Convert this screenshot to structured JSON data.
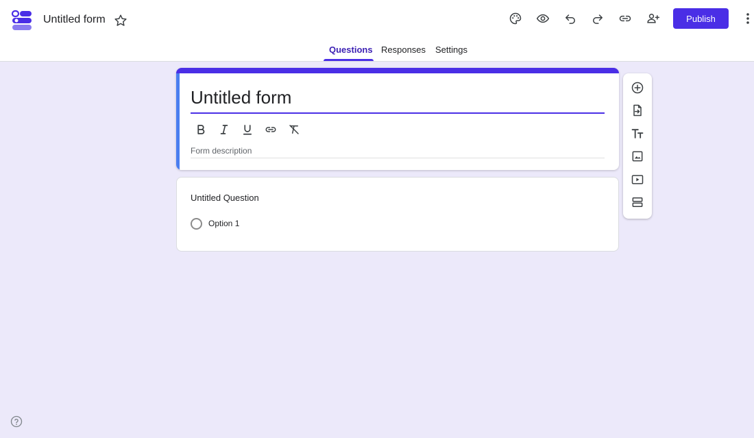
{
  "header": {
    "form_title": "Untitled form",
    "publish_label": "Publish",
    "icons": [
      "logo-icon",
      "star-icon",
      "palette-icon",
      "eye-icon",
      "undo-icon",
      "redo-icon",
      "link-icon",
      "add-person-icon",
      "more-vert-icon"
    ]
  },
  "tabs": [
    {
      "label": "Questions",
      "active": true
    },
    {
      "label": "Responses",
      "active": false
    },
    {
      "label": "Settings",
      "active": false
    }
  ],
  "title_card": {
    "title": "Untitled form",
    "description_placeholder": "Form description",
    "format_icons": [
      "bold-icon",
      "italic-icon",
      "underline-icon",
      "link-icon",
      "clear-format-icon"
    ]
  },
  "question_card": {
    "title": "Untitled Question",
    "options": [
      "Option 1"
    ]
  },
  "side_toolbar": {
    "icons": [
      "add-circle-icon",
      "import-icon",
      "title-text-icon",
      "image-icon",
      "video-icon",
      "section-icon"
    ]
  },
  "colors": {
    "accent": "#4a2ee6",
    "background": "#ece9fa",
    "card_left_marker": "#4a7ef0"
  }
}
